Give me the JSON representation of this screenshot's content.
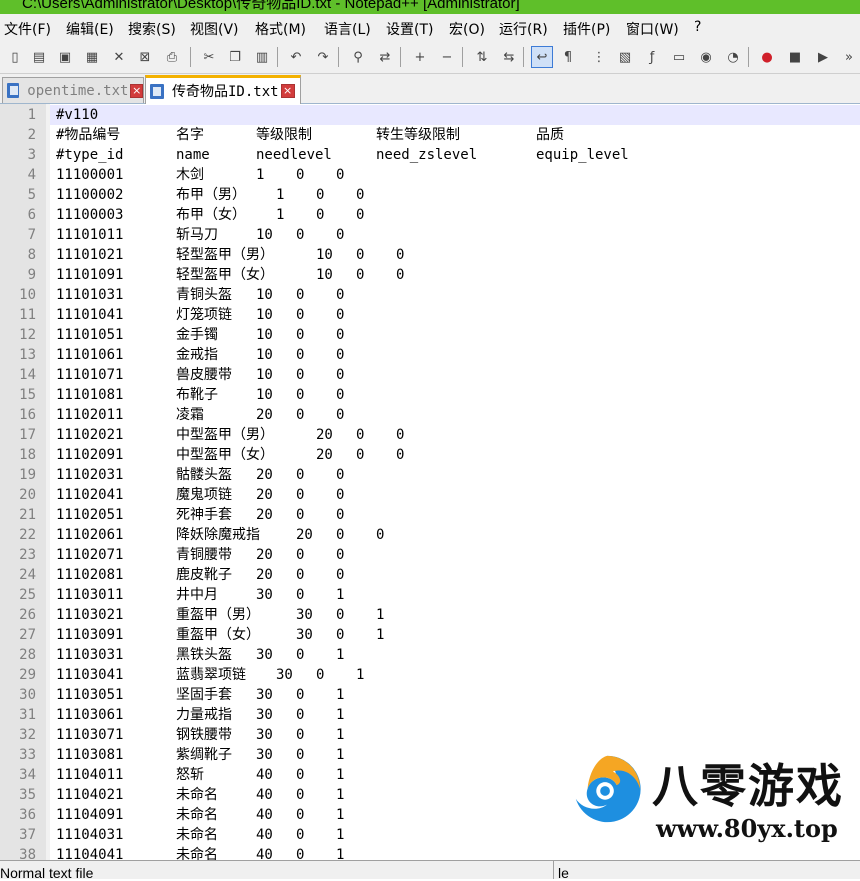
{
  "window": {
    "title": "C:\\Users\\Administrator\\Desktop\\传奇物品ID.txt - Notepad++ [Administrator]"
  },
  "menu": [
    "文件(F)",
    "编辑(E)",
    "搜索(S)",
    "视图(V)",
    "格式(M)",
    "语言(L)",
    "设置(T)",
    "宏(O)",
    "运行(R)",
    "插件(P)",
    "窗口(W)",
    "?"
  ],
  "toolbar": {
    "buttons": [
      "new-file-icon",
      "open-file-icon",
      "save-icon",
      "save-all-icon",
      "close-icon",
      "close-all-icon",
      "print-icon",
      "cut-icon",
      "copy-icon",
      "paste-icon",
      "undo-icon",
      "redo-icon",
      "find-icon",
      "replace-icon",
      "zoom-in-icon",
      "zoom-out-icon",
      "sync-vertical-icon",
      "sync-horizontal-icon",
      "word-wrap-icon",
      "show-all-chars-icon",
      "indent-guide-icon",
      "document-map-icon",
      "function-list-icon",
      "folder-as-workspace-icon",
      "monitoring-icon",
      "preview-icon",
      "record-macro-icon",
      "stop-recording-icon",
      "play-macro-icon",
      "run-macro-multiple-icon"
    ]
  },
  "tabs": [
    {
      "label": "opentime.txt",
      "active": false
    },
    {
      "label": "传奇物品ID.txt",
      "active": true
    }
  ],
  "editor": {
    "line_numbers": [
      "1",
      "2",
      "3",
      "4",
      "5",
      "6",
      "7",
      "8",
      "9",
      "10",
      "11",
      "12",
      "13",
      "14",
      "15",
      "16",
      "17",
      "18",
      "19",
      "20",
      "21",
      "22",
      "23",
      "24",
      "25",
      "26",
      "27",
      "28",
      "29",
      "30",
      "31",
      "32",
      "33",
      "34",
      "35",
      "36",
      "37",
      "38"
    ],
    "lines": [
      [
        "#v110"
      ],
      [
        "#物品编号",
        "名字",
        "等级限制",
        "转生等级限制",
        "品质"
      ],
      [
        "#type_id",
        "name",
        "needlevel",
        "need_zslevel",
        "equip_level"
      ],
      [
        "11100001",
        "木剑",
        "1",
        "0",
        "0"
      ],
      [
        "11100002",
        "布甲（男）",
        "1",
        "0",
        "0"
      ],
      [
        "11100003",
        "布甲（女）",
        "1",
        "0",
        "0"
      ],
      [
        "11101011",
        "斩马刀",
        "10",
        "0",
        "0"
      ],
      [
        "11101021",
        "轻型盔甲（男）",
        "10",
        "0",
        "0"
      ],
      [
        "11101091",
        "轻型盔甲（女）",
        "10",
        "0",
        "0"
      ],
      [
        "11101031",
        "青铜头盔",
        "10",
        "0",
        "0"
      ],
      [
        "11101041",
        "灯笼项链",
        "10",
        "0",
        "0"
      ],
      [
        "11101051",
        "金手镯",
        "10",
        "0",
        "0"
      ],
      [
        "11101061",
        "金戒指",
        "10",
        "0",
        "0"
      ],
      [
        "11101071",
        "兽皮腰带",
        "10",
        "0",
        "0"
      ],
      [
        "11101081",
        "布靴子",
        "10",
        "0",
        "0"
      ],
      [
        "11102011",
        "凌霜",
        "20",
        "0",
        "0"
      ],
      [
        "11102021",
        "中型盔甲（男）",
        "20",
        "0",
        "0"
      ],
      [
        "11102091",
        "中型盔甲（女）",
        "20",
        "0",
        "0"
      ],
      [
        "11102031",
        "骷髅头盔",
        "20",
        "0",
        "0"
      ],
      [
        "11102041",
        "魔鬼项链",
        "20",
        "0",
        "0"
      ],
      [
        "11102051",
        "死神手套",
        "20",
        "0",
        "0"
      ],
      [
        "11102061",
        "降妖除魔戒指",
        "20",
        "0",
        "0"
      ],
      [
        "11102071",
        "青铜腰带",
        "20",
        "0",
        "0"
      ],
      [
        "11102081",
        "鹿皮靴子",
        "20",
        "0",
        "0"
      ],
      [
        "11103011",
        "井中月",
        "30",
        "0",
        "1"
      ],
      [
        "11103021",
        "重盔甲（男）",
        "30",
        "0",
        "1"
      ],
      [
        "11103091",
        "重盔甲（女）",
        "30",
        "0",
        "1"
      ],
      [
        "11103031",
        "黑铁头盔",
        "30",
        "0",
        "1"
      ],
      [
        "11103041",
        "蓝翡翠项链",
        "30",
        "0",
        "1"
      ],
      [
        "11103051",
        "坚固手套",
        "30",
        "0",
        "1"
      ],
      [
        "11103061",
        "力量戒指",
        "30",
        "0",
        "1"
      ],
      [
        "11103071",
        "钢铁腰带",
        "30",
        "0",
        "1"
      ],
      [
        "11103081",
        "紫绸靴子",
        "30",
        "0",
        "1"
      ],
      [
        "11104011",
        "怒斩",
        "40",
        "0",
        "1"
      ],
      [
        "11104021",
        "未命名",
        "40",
        "0",
        "1"
      ],
      [
        "11104091",
        "未命名",
        "40",
        "0",
        "1"
      ],
      [
        "11104031",
        "未命名",
        "40",
        "0",
        "1"
      ],
      [
        "11104041",
        "未命名",
        "40",
        "0",
        "1"
      ]
    ]
  },
  "watermark": {
    "title": "八零游戏",
    "url": "www.80yx.top"
  },
  "status": {
    "left": "Normal text file",
    "right": "le"
  },
  "colors": {
    "title_bar": "#5fbf2a",
    "active_tab_accent": "#f3b100",
    "current_line": "#e8e8ff",
    "gutter": "#e4e4e4",
    "line_number": "#808080"
  }
}
